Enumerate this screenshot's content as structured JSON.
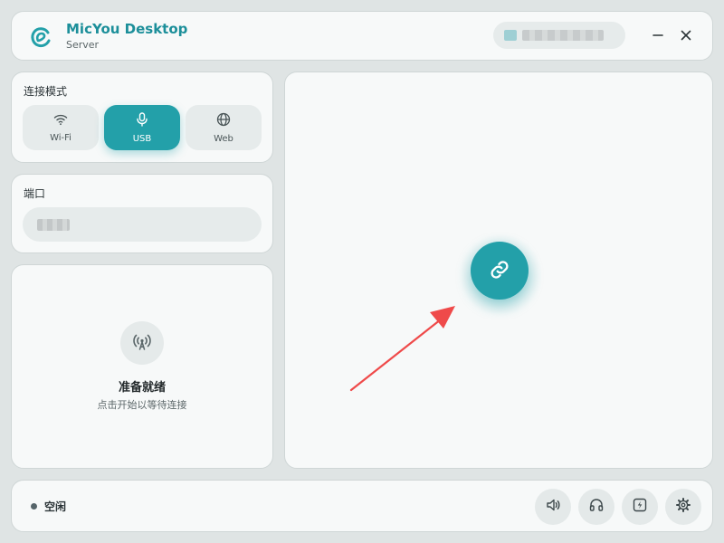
{
  "header": {
    "title": "MicYou Desktop",
    "subtitle": "Server",
    "ip_address": "",
    "logo_icon": "micyou-logo-icon",
    "minimize_icon": "minimize-icon",
    "close_icon": "close-icon"
  },
  "connection_mode": {
    "label": "连接模式",
    "options": [
      {
        "label": "Wi-Fi",
        "icon": "wifi-icon",
        "selected": false
      },
      {
        "label": "USB",
        "icon": "microphone-icon",
        "selected": true
      },
      {
        "label": "Web",
        "icon": "globe-icon",
        "selected": false
      }
    ]
  },
  "port": {
    "label": "端口",
    "value": ""
  },
  "status_panel": {
    "icon": "antenna-icon",
    "title": "准备就绪",
    "hint": "点击开始以等待连接"
  },
  "main_panel": {
    "connect_icon": "link-icon"
  },
  "footer": {
    "status": "空闲",
    "tools": [
      {
        "name": "volume",
        "icon": "volume-icon"
      },
      {
        "name": "headphones",
        "icon": "headphones-icon"
      },
      {
        "name": "activity",
        "icon": "activity-icon"
      },
      {
        "name": "settings",
        "icon": "gear-icon"
      }
    ]
  },
  "colors": {
    "accent": "#23a0a9",
    "title": "#1c8f9a",
    "background": "#dfe4e4",
    "card": "#f7f9f9",
    "arrow": "#ef4a4a"
  }
}
